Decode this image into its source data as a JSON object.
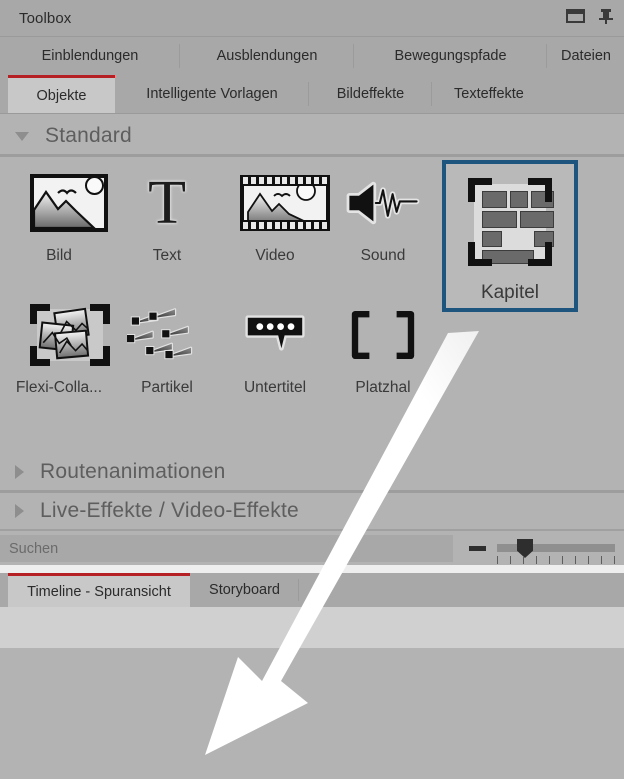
{
  "titlebar": {
    "title": "Toolbox",
    "window_icon": "window-icon",
    "pin_icon": "pin-icon"
  },
  "tabs_row1": [
    {
      "label": "Einblendungen",
      "active": false
    },
    {
      "label": "Ausblendungen",
      "active": false
    },
    {
      "label": "Bewegungspfade",
      "active": false
    },
    {
      "label": "Dateien",
      "active": false
    }
  ],
  "tabs_row2": [
    {
      "label": "Objekte",
      "active": true
    },
    {
      "label": "Intelligente Vorlagen",
      "active": false
    },
    {
      "label": "Bildeffekte",
      "active": false
    },
    {
      "label": "Texteffekte",
      "active": false
    }
  ],
  "sections": [
    {
      "label": "Standard",
      "expanded": true
    },
    {
      "label": "Routenanimationen",
      "expanded": false
    },
    {
      "label": "Live-Effekte / Video-Effekte",
      "expanded": false
    }
  ],
  "tiles": [
    {
      "label": "Bild",
      "icon": "image-icon",
      "selected": false
    },
    {
      "label": "Text",
      "icon": "text-icon",
      "selected": false
    },
    {
      "label": "Video",
      "icon": "video-icon",
      "selected": false
    },
    {
      "label": "Sound",
      "icon": "sound-icon",
      "selected": false
    },
    {
      "label": "Kapitel",
      "icon": "chapter-icon",
      "selected": true
    },
    {
      "label": "Flexi-Colla...",
      "icon": "collage-icon",
      "selected": false
    },
    {
      "label": "Partikel",
      "icon": "particle-icon",
      "selected": false
    },
    {
      "label": "Untertitel",
      "icon": "subtitle-icon",
      "selected": false
    },
    {
      "label": "Platzhal",
      "icon": "placeholder-icon",
      "selected": false
    }
  ],
  "search": {
    "value": "",
    "placeholder": "Suchen",
    "zoom_out_icon": "minus-icon",
    "slider_position_percent": 18
  },
  "bottom_tabs": [
    {
      "label": "Timeline - Spuransicht",
      "active": true
    },
    {
      "label": "Storyboard",
      "active": false
    }
  ],
  "annotation": {
    "type": "arrow-overlay",
    "color": "#ffffff",
    "points_from": "Kapitel",
    "points_to": "Timeline - Spuransicht"
  },
  "colors": {
    "panel_bg": "#b3b3b3",
    "titlebar_bg": "#a8a8a8",
    "active_tab_bg": "#c8c8c8",
    "active_tab_accent": "#b52025",
    "selection_border": "#1d557f",
    "section_title": "#5e5e5e"
  }
}
